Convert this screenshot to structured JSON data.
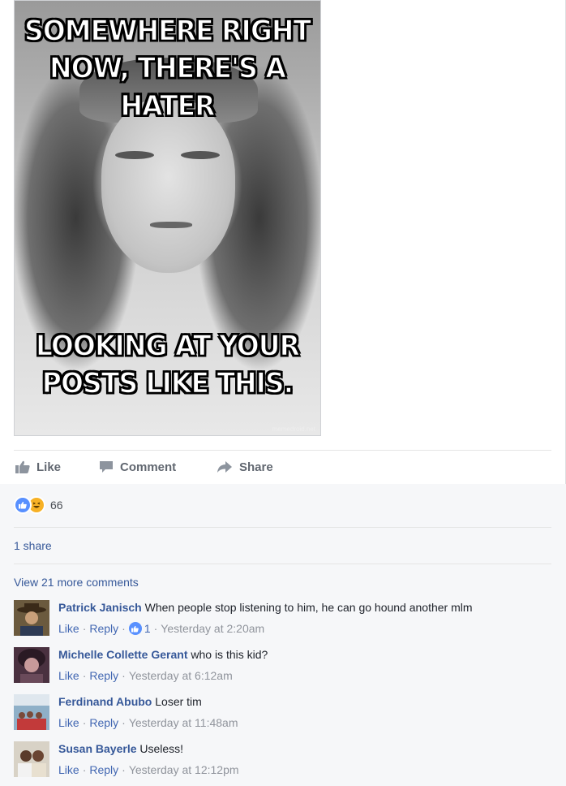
{
  "post": {
    "meme_top": "SOMEWHERE RIGHT NOW, THERE'S A HATER",
    "meme_bottom": "LOOKING AT YOUR POSTS LIKE THIS.",
    "watermark": "memedroid.net"
  },
  "actions": {
    "like_label": "Like",
    "comment_label": "Comment",
    "share_label": "Share"
  },
  "reactions": {
    "count": "66",
    "icons": [
      "like-icon",
      "haha-icon"
    ]
  },
  "shares": {
    "label": "1 share"
  },
  "comments_section": {
    "view_more": "View 21 more comments",
    "items": [
      {
        "author": "Patrick Janisch",
        "text": "When people stop listening to him, he can go hound another mlm",
        "like": "Like",
        "reply": "Reply",
        "likes": "1",
        "time": "Yesterday at 2:20am"
      },
      {
        "author": "Michelle Collette Gerant",
        "text": "who is this kid?",
        "like": "Like",
        "reply": "Reply",
        "time": "Yesterday at 6:12am"
      },
      {
        "author": "Ferdinand Abubo",
        "text": "Loser tim",
        "like": "Like",
        "reply": "Reply",
        "time": "Yesterday at 11:48am"
      },
      {
        "author": "Susan Bayerle",
        "text": "Useless!",
        "like": "Like",
        "reply": "Reply",
        "time": "Yesterday at 12:12pm"
      }
    ]
  },
  "colors": {
    "link": "#365899",
    "meta": "#90949c",
    "action": "#616770",
    "like_blue": "#5890ff"
  }
}
